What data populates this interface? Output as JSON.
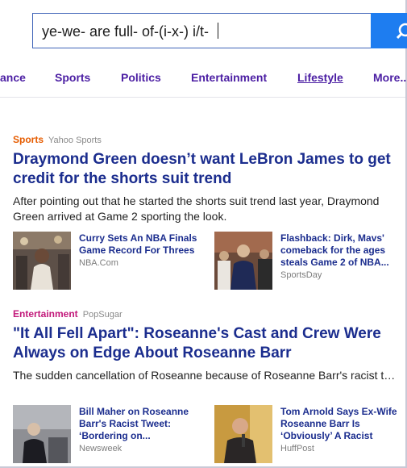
{
  "search": {
    "value": "ye-we- are full- of-(i-x-) i/t-",
    "icon": "search-icon"
  },
  "nav": [
    {
      "label": "ance"
    },
    {
      "label": "Sports"
    },
    {
      "label": "Politics"
    },
    {
      "label": "Entertainment"
    },
    {
      "label": "Lifestyle"
    },
    {
      "label": "More..."
    }
  ],
  "stories": [
    {
      "category": "Sports",
      "category_color": "#e65c00",
      "source": "Yahoo Sports",
      "headline": "Draymond Green doesn’t want LeBron James to get credit for the shorts suit trend",
      "summary": "After pointing out that he started the shorts suit trend last year, Draymond Green arrived at Game 2 sporting the look.",
      "related": [
        {
          "title": "Curry Sets An NBA Finals Game Record For Threes",
          "source": "NBA.Com"
        },
        {
          "title": "Flashback: Dirk, Mavs' comeback for the ages steals Game 2 of NBA...",
          "source": "SportsDay"
        }
      ]
    },
    {
      "category": "Entertainment",
      "category_color": "#c2187a",
      "source": "PopSugar",
      "headline": "\"It All Fell Apart\": Roseanne's Cast and Crew Were Always on Edge About Roseanne Barr",
      "summary": "The sudden cancellation of Roseanne because of Roseanne Barr's racist tweets may have come as a shock to fans, the cast, and crew of the show,...",
      "related": [
        {
          "title": "Bill Maher on Roseanne Barr's Racist Tweet: ‘Bordering on...",
          "source": "Newsweek"
        },
        {
          "title": "Tom Arnold Says Ex-Wife Roseanne Barr Is ‘Obviously’ A Racist",
          "source": "HuffPost"
        }
      ]
    }
  ]
}
